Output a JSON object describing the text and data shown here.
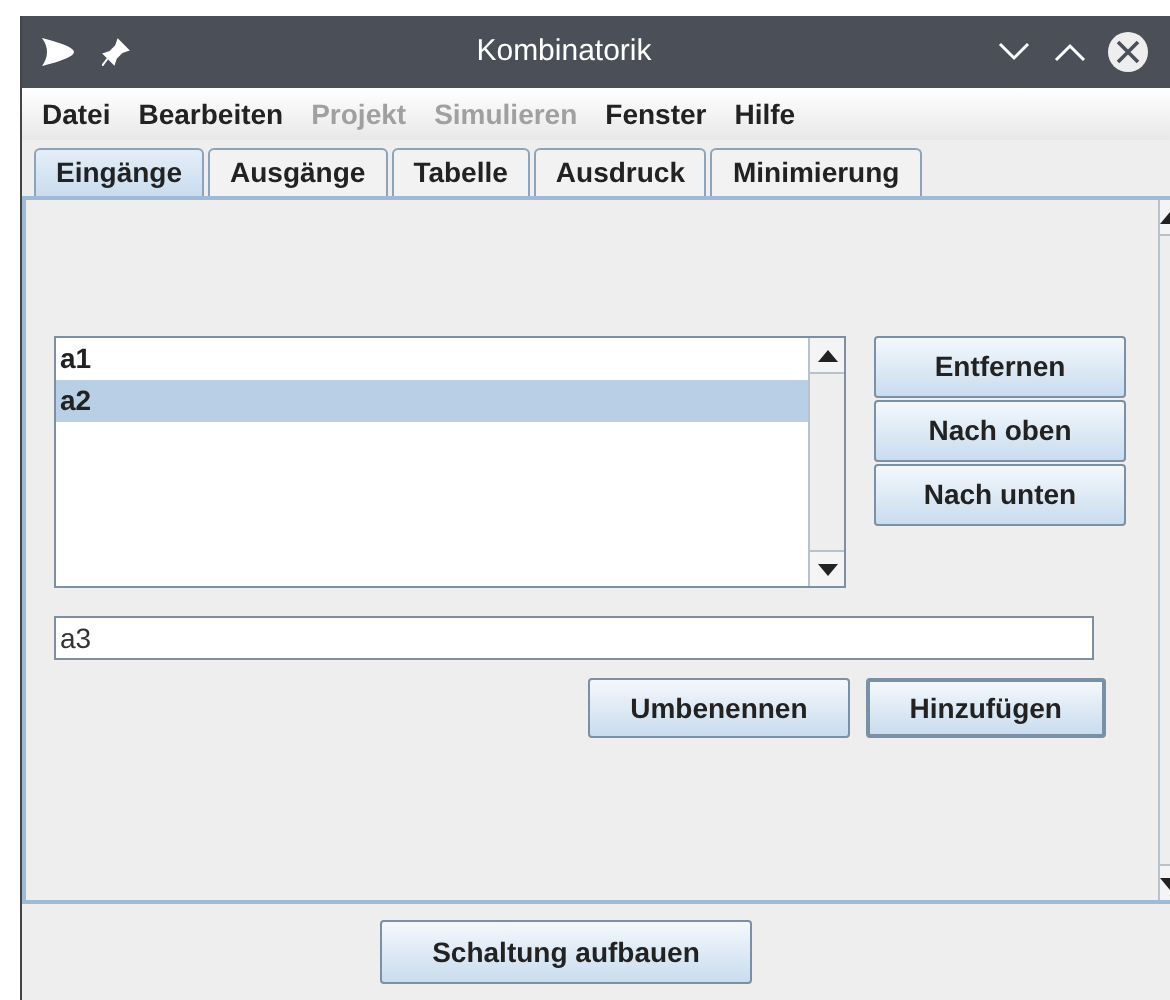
{
  "window": {
    "title": "Kombinatorik"
  },
  "menu": [
    {
      "label": "Datei",
      "disabled": false
    },
    {
      "label": "Bearbeiten",
      "disabled": false
    },
    {
      "label": "Projekt",
      "disabled": true
    },
    {
      "label": "Simulieren",
      "disabled": true
    },
    {
      "label": "Fenster",
      "disabled": false
    },
    {
      "label": "Hilfe",
      "disabled": false
    }
  ],
  "tabs": [
    {
      "label": "Eingänge",
      "selected": true
    },
    {
      "label": "Ausgänge",
      "selected": false
    },
    {
      "label": "Tabelle",
      "selected": false
    },
    {
      "label": "Ausdruck",
      "selected": false
    },
    {
      "label": "Minimierung",
      "selected": false
    }
  ],
  "inputs_list": [
    {
      "label": "a1",
      "selected": false
    },
    {
      "label": "a2",
      "selected": true
    }
  ],
  "side_buttons": [
    "Entfernen",
    "Nach oben",
    "Nach unten"
  ],
  "name_field": {
    "value": "a3"
  },
  "action_buttons": [
    {
      "label": "Umbenennen",
      "default": false
    },
    {
      "label": "Hinzufügen",
      "default": true
    }
  ],
  "build_button": "Schaltung aufbauen"
}
